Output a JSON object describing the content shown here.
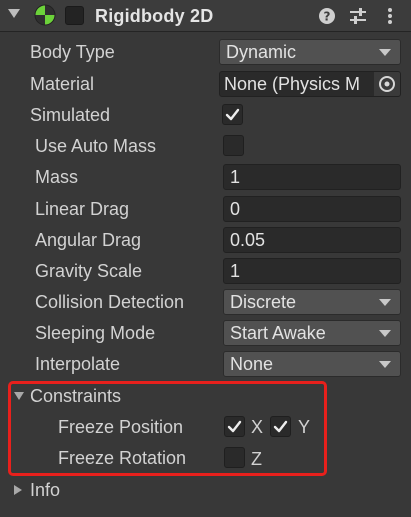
{
  "component": {
    "title": "Rigidbody 2D",
    "icons": [
      "foldout-arrow-icon",
      "rigidbody2d-icon",
      "help-icon",
      "preset-sliders-icon",
      "more-menu-icon"
    ]
  },
  "fields": {
    "body_type": {
      "label": "Body Type",
      "value": "Dynamic"
    },
    "material": {
      "label": "Material",
      "value": "None (Physics M"
    },
    "simulated": {
      "label": "Simulated",
      "checked": true
    },
    "use_auto_mass": {
      "label": "Use Auto Mass",
      "checked": false
    },
    "mass": {
      "label": "Mass",
      "value": "1"
    },
    "linear_drag": {
      "label": "Linear Drag",
      "value": "0"
    },
    "angular_drag": {
      "label": "Angular Drag",
      "value": "0.05"
    },
    "gravity_scale": {
      "label": "Gravity Scale",
      "value": "1"
    },
    "collision_detection": {
      "label": "Collision Detection",
      "value": "Discrete"
    },
    "sleeping_mode": {
      "label": "Sleeping Mode",
      "value": "Start Awake"
    },
    "interpolate": {
      "label": "Interpolate",
      "value": "None"
    }
  },
  "constraints": {
    "label": "Constraints",
    "expanded": true,
    "freeze_position": {
      "label": "Freeze Position",
      "x_label": "X",
      "y_label": "Y",
      "x": true,
      "y": true
    },
    "freeze_rotation": {
      "label": "Freeze Rotation",
      "z_label": "Z",
      "z": false
    }
  },
  "info": {
    "label": "Info",
    "expanded": false
  },
  "colors": {
    "background": "#383838",
    "highlight": "#e8201c",
    "icon_green": "#6cd23a"
  }
}
